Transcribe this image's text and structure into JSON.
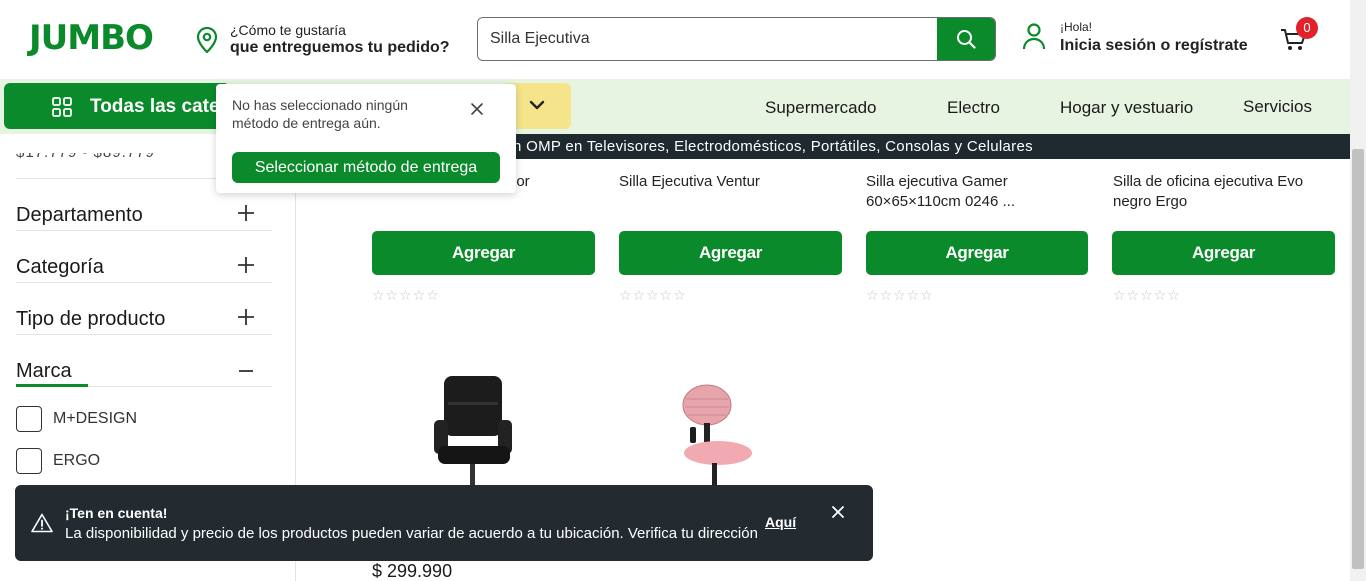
{
  "header": {
    "logo": "JUMBO",
    "delivery_line1": "¿Cómo te gustaría",
    "delivery_line2": "que entreguemos tu pedido?",
    "search_value": "Silla Ejecutiva",
    "hello": "¡Hola!",
    "signin": "Inicia sesión o regístrate",
    "cart_count": "0"
  },
  "nav": {
    "categories_label": "Todas las categorías",
    "links": [
      "Supermercado",
      "Electro",
      "Hogar y vestuario",
      "Servicios"
    ]
  },
  "promo_strip": "n OMP en Televisores, Electrodomésticos, Portátiles, Consolas y Celulares",
  "tooltip": {
    "message": "No has seleccionado ningún método de entrega aún.",
    "button": "Seleccionar método de entrega"
  },
  "sidebar": {
    "price_cut": "$17.779 - $89.779",
    "filters": [
      "Departamento",
      "Categoría",
      "Tipo de producto",
      "Marca"
    ],
    "brands": [
      "M+DESIGN",
      "ERGO"
    ]
  },
  "products": [
    {
      "name": "rior",
      "button": "Agregar"
    },
    {
      "name": "Silla Ejecutiva Ventur",
      "button": "Agregar"
    },
    {
      "name": "Silla ejecutiva Gamer 60×65×110cm 0246 ...",
      "button": "Agregar"
    },
    {
      "name": "Silla de oficina ejecutiva Evo negro Ergo",
      "button": "Agregar"
    }
  ],
  "price_visible": "$ 299.990",
  "notice": {
    "title": "¡Ten en cuenta!",
    "text": "La disponibilidad y precio de los productos pueden variar de acuerdo a tu ubicación. Verifica tu dirección",
    "link": "Aquí"
  },
  "colors": {
    "brand_green": "#0a8a2a",
    "nav_bg": "#e6f4e1",
    "accent_yellow": "#f5e48a",
    "dark": "#232b30",
    "badge_red": "#e0222b"
  },
  "icons": [
    "location-pin-icon",
    "search-icon",
    "user-icon",
    "cart-icon",
    "grid-icon",
    "chevron-down-icon",
    "close-icon",
    "plus-icon",
    "minus-icon",
    "warning-icon",
    "star-icon"
  ]
}
